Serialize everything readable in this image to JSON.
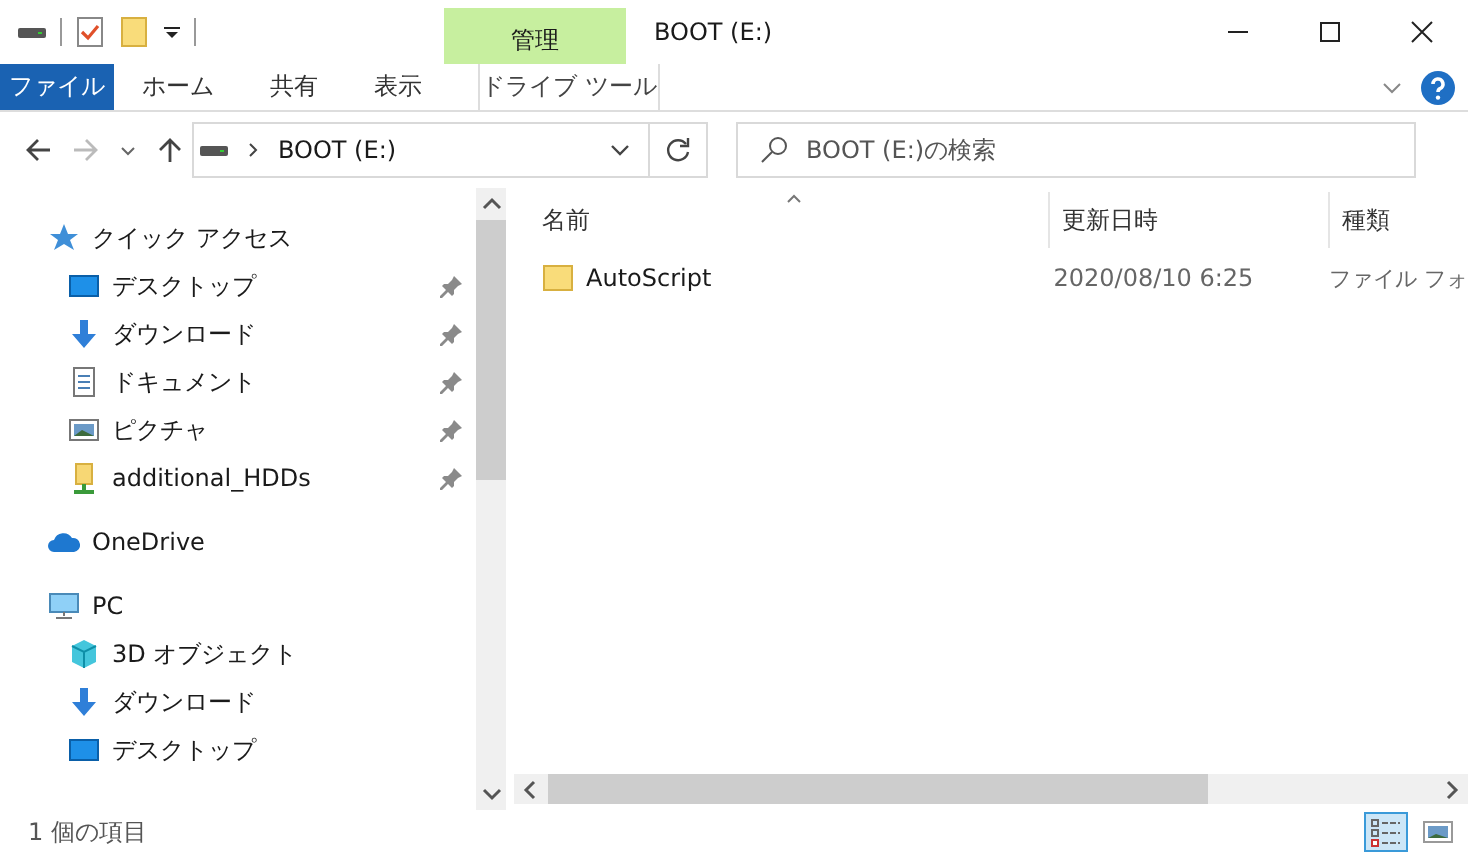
{
  "window": {
    "title": "BOOT (E:)"
  },
  "contextual_group": "管理",
  "ribbon_tabs": [
    {
      "label": "ファイル",
      "kind": "file",
      "selected": false
    },
    {
      "label": "ホーム",
      "kind": "normal",
      "selected": false
    },
    {
      "label": "共有",
      "kind": "normal",
      "selected": false
    },
    {
      "label": "表示",
      "kind": "normal",
      "selected": false
    },
    {
      "label": "ドライブ ツール",
      "kind": "contextual",
      "selected": false
    }
  ],
  "address": {
    "path": "BOOT (E:)"
  },
  "search": {
    "placeholder": "BOOT (E:)の検索"
  },
  "nav": [
    {
      "label": "クイック アクセス",
      "kind": "star",
      "children": [
        {
          "label": "デスクトップ",
          "kind": "desktop",
          "pinned": true
        },
        {
          "label": "ダウンロード",
          "kind": "download",
          "pinned": true
        },
        {
          "label": "ドキュメント",
          "kind": "document",
          "pinned": true
        },
        {
          "label": "ピクチャ",
          "kind": "picture",
          "pinned": true
        },
        {
          "label": "additional_HDDs",
          "kind": "netfolder",
          "pinned": true
        }
      ]
    },
    {
      "label": "OneDrive",
      "kind": "cloud"
    },
    {
      "label": "PC",
      "kind": "pc",
      "children": [
        {
          "label": "3D オブジェクト",
          "kind": "cube",
          "pinned": false
        },
        {
          "label": "ダウンロード",
          "kind": "download",
          "pinned": false
        },
        {
          "label": "デスクトップ",
          "kind": "desktop",
          "pinned": false
        }
      ]
    }
  ],
  "columns": [
    "名前",
    "更新日時",
    "種類"
  ],
  "rows": [
    {
      "name": "AutoScript",
      "modified": "2020/08/10 6:25",
      "type": "ファイル フォ"
    }
  ],
  "status_bar": {
    "item_count": "1 個の項目"
  },
  "views": [
    {
      "kind": "details",
      "selected": true
    },
    {
      "kind": "large_icons",
      "selected": false
    }
  ]
}
